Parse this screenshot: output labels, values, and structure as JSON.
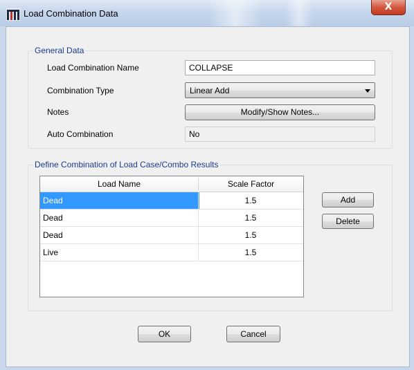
{
  "window": {
    "title": "Load Combination Data",
    "close_glyph": "X"
  },
  "general": {
    "caption": "General Data",
    "name_label": "Load Combination Name",
    "name_value": "COLLAPSE",
    "type_label": "Combination Type",
    "type_value": "Linear Add",
    "notes_label": "Notes",
    "notes_button": "Modify/Show Notes...",
    "auto_label": "Auto Combination",
    "auto_value": "No"
  },
  "define": {
    "caption": "Define Combination of Load Case/Combo Results",
    "columns": [
      "Load Name",
      "Scale Factor"
    ],
    "rows": [
      {
        "name": "Dead",
        "factor": "1.5",
        "selected": true
      },
      {
        "name": "Dead",
        "factor": "1.5",
        "selected": false
      },
      {
        "name": "Dead",
        "factor": "1.5",
        "selected": false
      },
      {
        "name": "Live",
        "factor": "1.5",
        "selected": false
      }
    ],
    "add_button": "Add",
    "delete_button": "Delete"
  },
  "footer": {
    "ok_button": "OK",
    "cancel_button": "Cancel"
  },
  "colors": {
    "accent_caption": "#1a3a8c",
    "selection": "#3399ff",
    "close_button": "#c9442a"
  },
  "icons": [
    "app-icon",
    "close-icon",
    "chevron-down-icon"
  ]
}
